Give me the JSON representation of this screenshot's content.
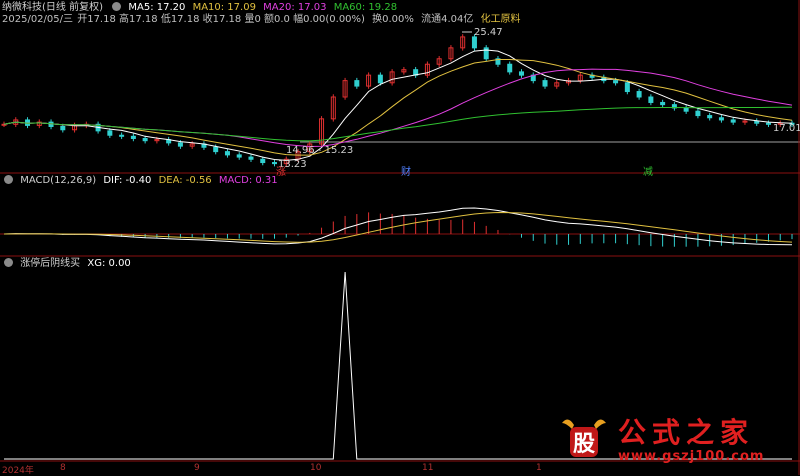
{
  "header": {
    "stock_name": "纳微科技",
    "period": "(日线 前复权)",
    "ma5": "MA5: 17.20",
    "ma10": "MA10: 17.09",
    "ma20": "MA20: 17.03",
    "ma60": "MA60: 19.28",
    "date_line": "2025/02/05/三",
    "ohlc": "开17.18 高17.18 低17.18 收17.18",
    "vol": "量0",
    "amount": "额0.0",
    "change": "幅0.00(0.00%)",
    "turnover": "换0.00%",
    "float_cap": "流通4.04亿",
    "industry": "化工原料"
  },
  "price_annotations": {
    "high": "25.47",
    "low": "13.23",
    "range": "14.96 - 15.23",
    "last": "17.01"
  },
  "markers": [
    "涨",
    "财",
    "减"
  ],
  "macd_header": {
    "title": "MACD(12,26,9)",
    "dif": "DIF: -0.40",
    "dea": "DEA: -0.56",
    "macd": "MACD: 0.31"
  },
  "xg_header": {
    "title": "涨停后阴线买",
    "xg": "XG: 0.00"
  },
  "date_axis": [
    "2024年",
    "8",
    "9",
    "10",
    "11",
    "1"
  ],
  "watermark": {
    "brand": "公式之家",
    "url": "www.gszj100.com",
    "logo_char": "股"
  },
  "colors": {
    "ma5": "#ffffff",
    "ma10": "#e0c040",
    "ma20": "#e040e0",
    "ma60": "#30c030",
    "up": "#e03030",
    "down": "#30d0d0",
    "grid": "#8a1010"
  },
  "chart_data": [
    {
      "type": "candlestick",
      "title": "纳微科技 (日线 前复权)",
      "series_names": [
        "MA5",
        "MA10",
        "MA20",
        "MA60"
      ],
      "approx_close": [
        17.0,
        17.4,
        16.9,
        17.2,
        16.8,
        16.5,
        16.9,
        17.0,
        16.4,
        16.0,
        15.9,
        15.7,
        15.5,
        15.6,
        15.3,
        15.0,
        15.2,
        14.9,
        14.5,
        14.2,
        14.0,
        13.8,
        13.5,
        13.4,
        13.8,
        14.5,
        15.2,
        17.5,
        19.5,
        21.0,
        20.5,
        21.5,
        20.8,
        21.8,
        22.0,
        21.5,
        22.5,
        23.0,
        24.0,
        25.0,
        24.0,
        23.0,
        22.5,
        21.8,
        21.5,
        21.0,
        20.5,
        20.8,
        21.0,
        21.5,
        21.3,
        21.0,
        20.8,
        20.0,
        19.5,
        19.0,
        18.8,
        18.5,
        18.2,
        17.8,
        17.6,
        17.4,
        17.2,
        17.3,
        17.1,
        17.0,
        17.1,
        17.0
      ],
      "ylim": [
        13.0,
        26.0
      ]
    },
    {
      "type": "bar",
      "title": "MACD(12,26,9)",
      "dif": -0.4,
      "dea": -0.56,
      "macd": 0.31
    },
    {
      "type": "line",
      "title": "涨停后阴线买",
      "xg": 0.0,
      "spike_index": 29,
      "ylim": [
        0,
        1
      ]
    }
  ]
}
